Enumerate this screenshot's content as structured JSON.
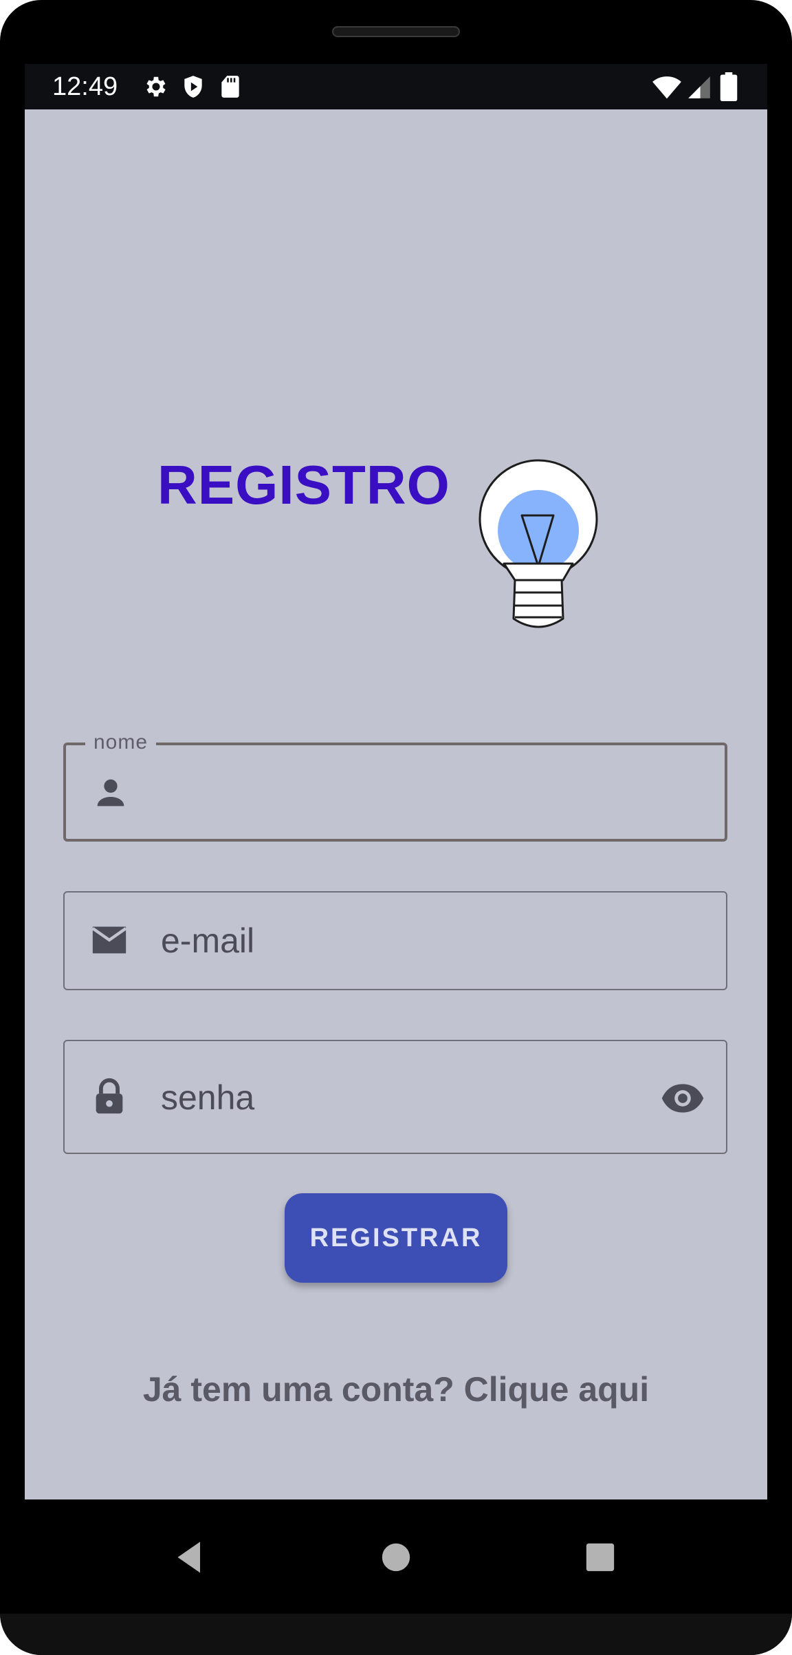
{
  "status_bar": {
    "time": "12:49",
    "left_icons": [
      "gear-icon",
      "shield-play-icon",
      "sd-card-icon"
    ],
    "right_icons": [
      "wifi-icon",
      "signal-icon",
      "battery-icon"
    ]
  },
  "header": {
    "title": "REGISTRO",
    "logo_icon": "lightbulb-icon"
  },
  "form": {
    "name": {
      "label": "nome",
      "value": "",
      "icon": "person-icon"
    },
    "email": {
      "placeholder": "e-mail",
      "icon": "mail-icon"
    },
    "password": {
      "placeholder": "senha",
      "icon": "lock-icon",
      "toggle_icon": "eye-icon"
    },
    "submit_label": "REGISTRAR"
  },
  "footer": {
    "login_link": "Já tem uma conta? Clique aqui"
  },
  "nav_bar": {
    "buttons": [
      "back-icon",
      "home-icon",
      "recents-icon"
    ]
  },
  "colors": {
    "background": "#c1c3d1",
    "title": "#3a0ec2",
    "button": "#3d4fb5",
    "bulb_glow": "#88b4ff"
  }
}
